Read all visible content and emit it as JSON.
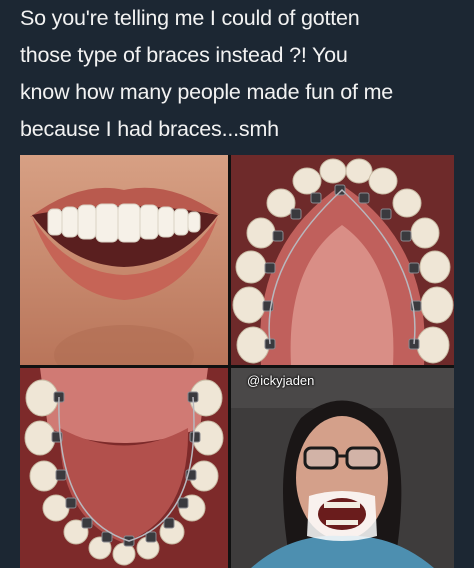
{
  "caption": {
    "lines": [
      "So you're telling me I could of gotten",
      "those type of braces instead ?! You",
      "know how many people made fun of me",
      "because I had braces...smh"
    ]
  },
  "watermark": "@ickyjaden",
  "colors": {
    "background": "#1c2733",
    "caption_text": "#f2f2f2"
  }
}
